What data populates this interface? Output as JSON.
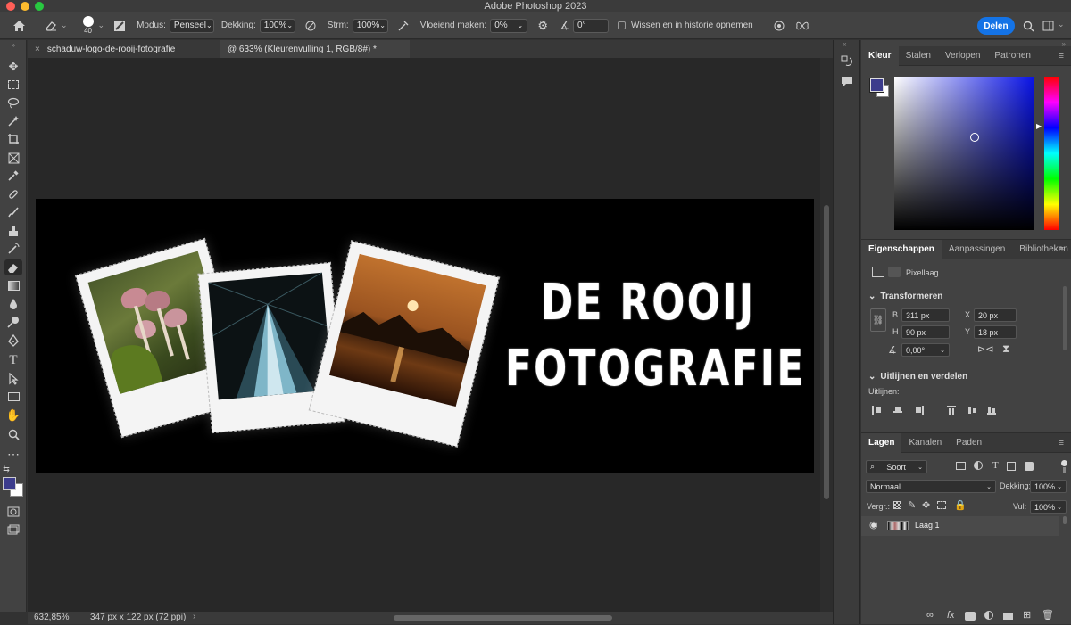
{
  "window": {
    "title": "Adobe Photoshop 2023"
  },
  "options_bar": {
    "brush_size": "40",
    "mode_label": "Modus:",
    "mode_value": "Penseel",
    "opacity_label": "Dekking:",
    "opacity_value": "100%",
    "flow_label": "Strm:",
    "flow_value": "100%",
    "smoothing_label": "Vloeiend maken:",
    "smoothing_value": "0%",
    "angle_value": "0°",
    "erase_history_label": "Wissen en in historie opnemen",
    "share_label": "Delen"
  },
  "document": {
    "tabs": [
      {
        "label": "schaduw-logo-de-rooij-fotografie"
      },
      {
        "label": "@ 633% (Kleurenvulling 1, RGB/8#) *"
      }
    ],
    "canvas_text_line1": "DE ROOIJ",
    "canvas_text_line2": "FOTOGRAFIE"
  },
  "status": {
    "zoom": "632,85%",
    "dimensions": "347 px x 122 px (72 ppi)"
  },
  "color_panel": {
    "tabs": [
      "Kleur",
      "Stalen",
      "Verlopen",
      "Patronen"
    ],
    "foreground": "#3c3c8c",
    "background": "#ffffff",
    "hue": "#0a14e6"
  },
  "properties_panel": {
    "tabs": [
      "Eigenschappen",
      "Aanpassingen",
      "Bibliotheken"
    ],
    "layer_type": "Pixellaag",
    "transform_title": "Transformeren",
    "b_label": "B",
    "b_value": "311 px",
    "x_label": "X",
    "x_value": "20 px",
    "h_label": "H",
    "h_value": "90 px",
    "y_label": "Y",
    "y_value": "18 px",
    "angle_value": "0,00°",
    "align_title": "Uitlijnen en verdelen",
    "align_label": "Uitlijnen:"
  },
  "layers_panel": {
    "tabs": [
      "Lagen",
      "Kanalen",
      "Paden"
    ],
    "filter_label": "Soort",
    "blend_mode": "Normaal",
    "opacity_label": "Dekking:",
    "opacity_value": "100%",
    "lock_label": "Vergr.:",
    "fill_label": "Vul:",
    "fill_value": "100%",
    "layers": [
      {
        "name": "Laag 1"
      }
    ]
  }
}
